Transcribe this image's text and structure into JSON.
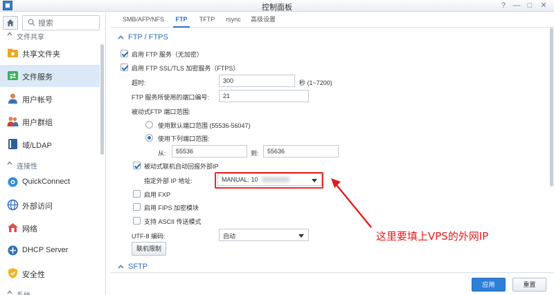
{
  "window": {
    "title": "控制面板",
    "controls": [
      "help-icon",
      "minimize-icon",
      "maximize-icon",
      "close-icon"
    ]
  },
  "sidebar": {
    "search_placeholder": "搜索",
    "sections": [
      {
        "label": "文件共享"
      },
      {
        "label": "连接性"
      },
      {
        "label": "系统"
      }
    ],
    "items": [
      {
        "label": "共享文件夹",
        "icon": "shared-folder-icon"
      },
      {
        "label": "文件服务",
        "icon": "file-services-icon",
        "active": true
      },
      {
        "label": "用户帐号",
        "icon": "user-icon"
      },
      {
        "label": "用户群组",
        "icon": "group-icon"
      },
      {
        "label": "域/LDAP",
        "icon": "domain-icon"
      },
      {
        "label": "QuickConnect",
        "icon": "quickconnect-icon"
      },
      {
        "label": "外部访问",
        "icon": "globe-icon"
      },
      {
        "label": "网络",
        "icon": "network-icon"
      },
      {
        "label": "DHCP Server",
        "icon": "dhcp-icon"
      },
      {
        "label": "安全性",
        "icon": "shield-icon"
      }
    ]
  },
  "tabs": [
    {
      "label": "SMB/AFP/NFS"
    },
    {
      "label": "FTP",
      "active": true
    },
    {
      "label": "TFTP"
    },
    {
      "label": "rsync"
    },
    {
      "label": "高级设置"
    }
  ],
  "ftp": {
    "group_title": "FTP / FTPS",
    "enable_ftp": {
      "label": "启用 FTP 服务（无加密）",
      "checked": true
    },
    "enable_ftps": {
      "label": "启用 FTP SSL/TLS 加密服务（FTPS）",
      "checked": true
    },
    "timeout": {
      "label": "超时:",
      "value": "300",
      "unit": "秒 (1~7200)"
    },
    "port": {
      "label": "FTP 服务所使用的端口编号:",
      "value": "21"
    },
    "passive_range_label": "被动式FTP 端口范围:",
    "use_default_range": {
      "label": "使用默认端口范围 (55536-56047)",
      "selected": false
    },
    "use_custom_range": {
      "label": "使用下列端口范围:",
      "selected": true
    },
    "from": {
      "label": "从:",
      "value": "55536"
    },
    "to": {
      "label": "到:",
      "value": "55636"
    },
    "auto_report_ip": {
      "label": "被动式联机自动回报外部IP",
      "checked": true
    },
    "external_ip": {
      "label": "指定外部 IP 地址:",
      "value": "MANUAL: 10"
    },
    "enable_fxp": {
      "label": "启用 FXP",
      "checked": false
    },
    "enable_fips": {
      "label": "启用 FIPS 加密模块",
      "checked": false
    },
    "ascii": {
      "label": "支持 ASCII 传送模式",
      "checked": false
    },
    "utf8": {
      "label": "UTF-8 编码:",
      "value": "自动"
    },
    "connection_limit_button": "联机限制"
  },
  "sftp": {
    "group_title": "SFTP"
  },
  "annotation": {
    "text": "这里要填上VPS的外网IP",
    "color": "#e41b1b"
  },
  "footer": {
    "apply": "应用",
    "reset": "重置"
  },
  "colors": {
    "accent": "#2a6ebb",
    "apply_button": "#2f7fd5",
    "highlight": "#e52a2a",
    "active_nav": "#dbe9f6"
  }
}
